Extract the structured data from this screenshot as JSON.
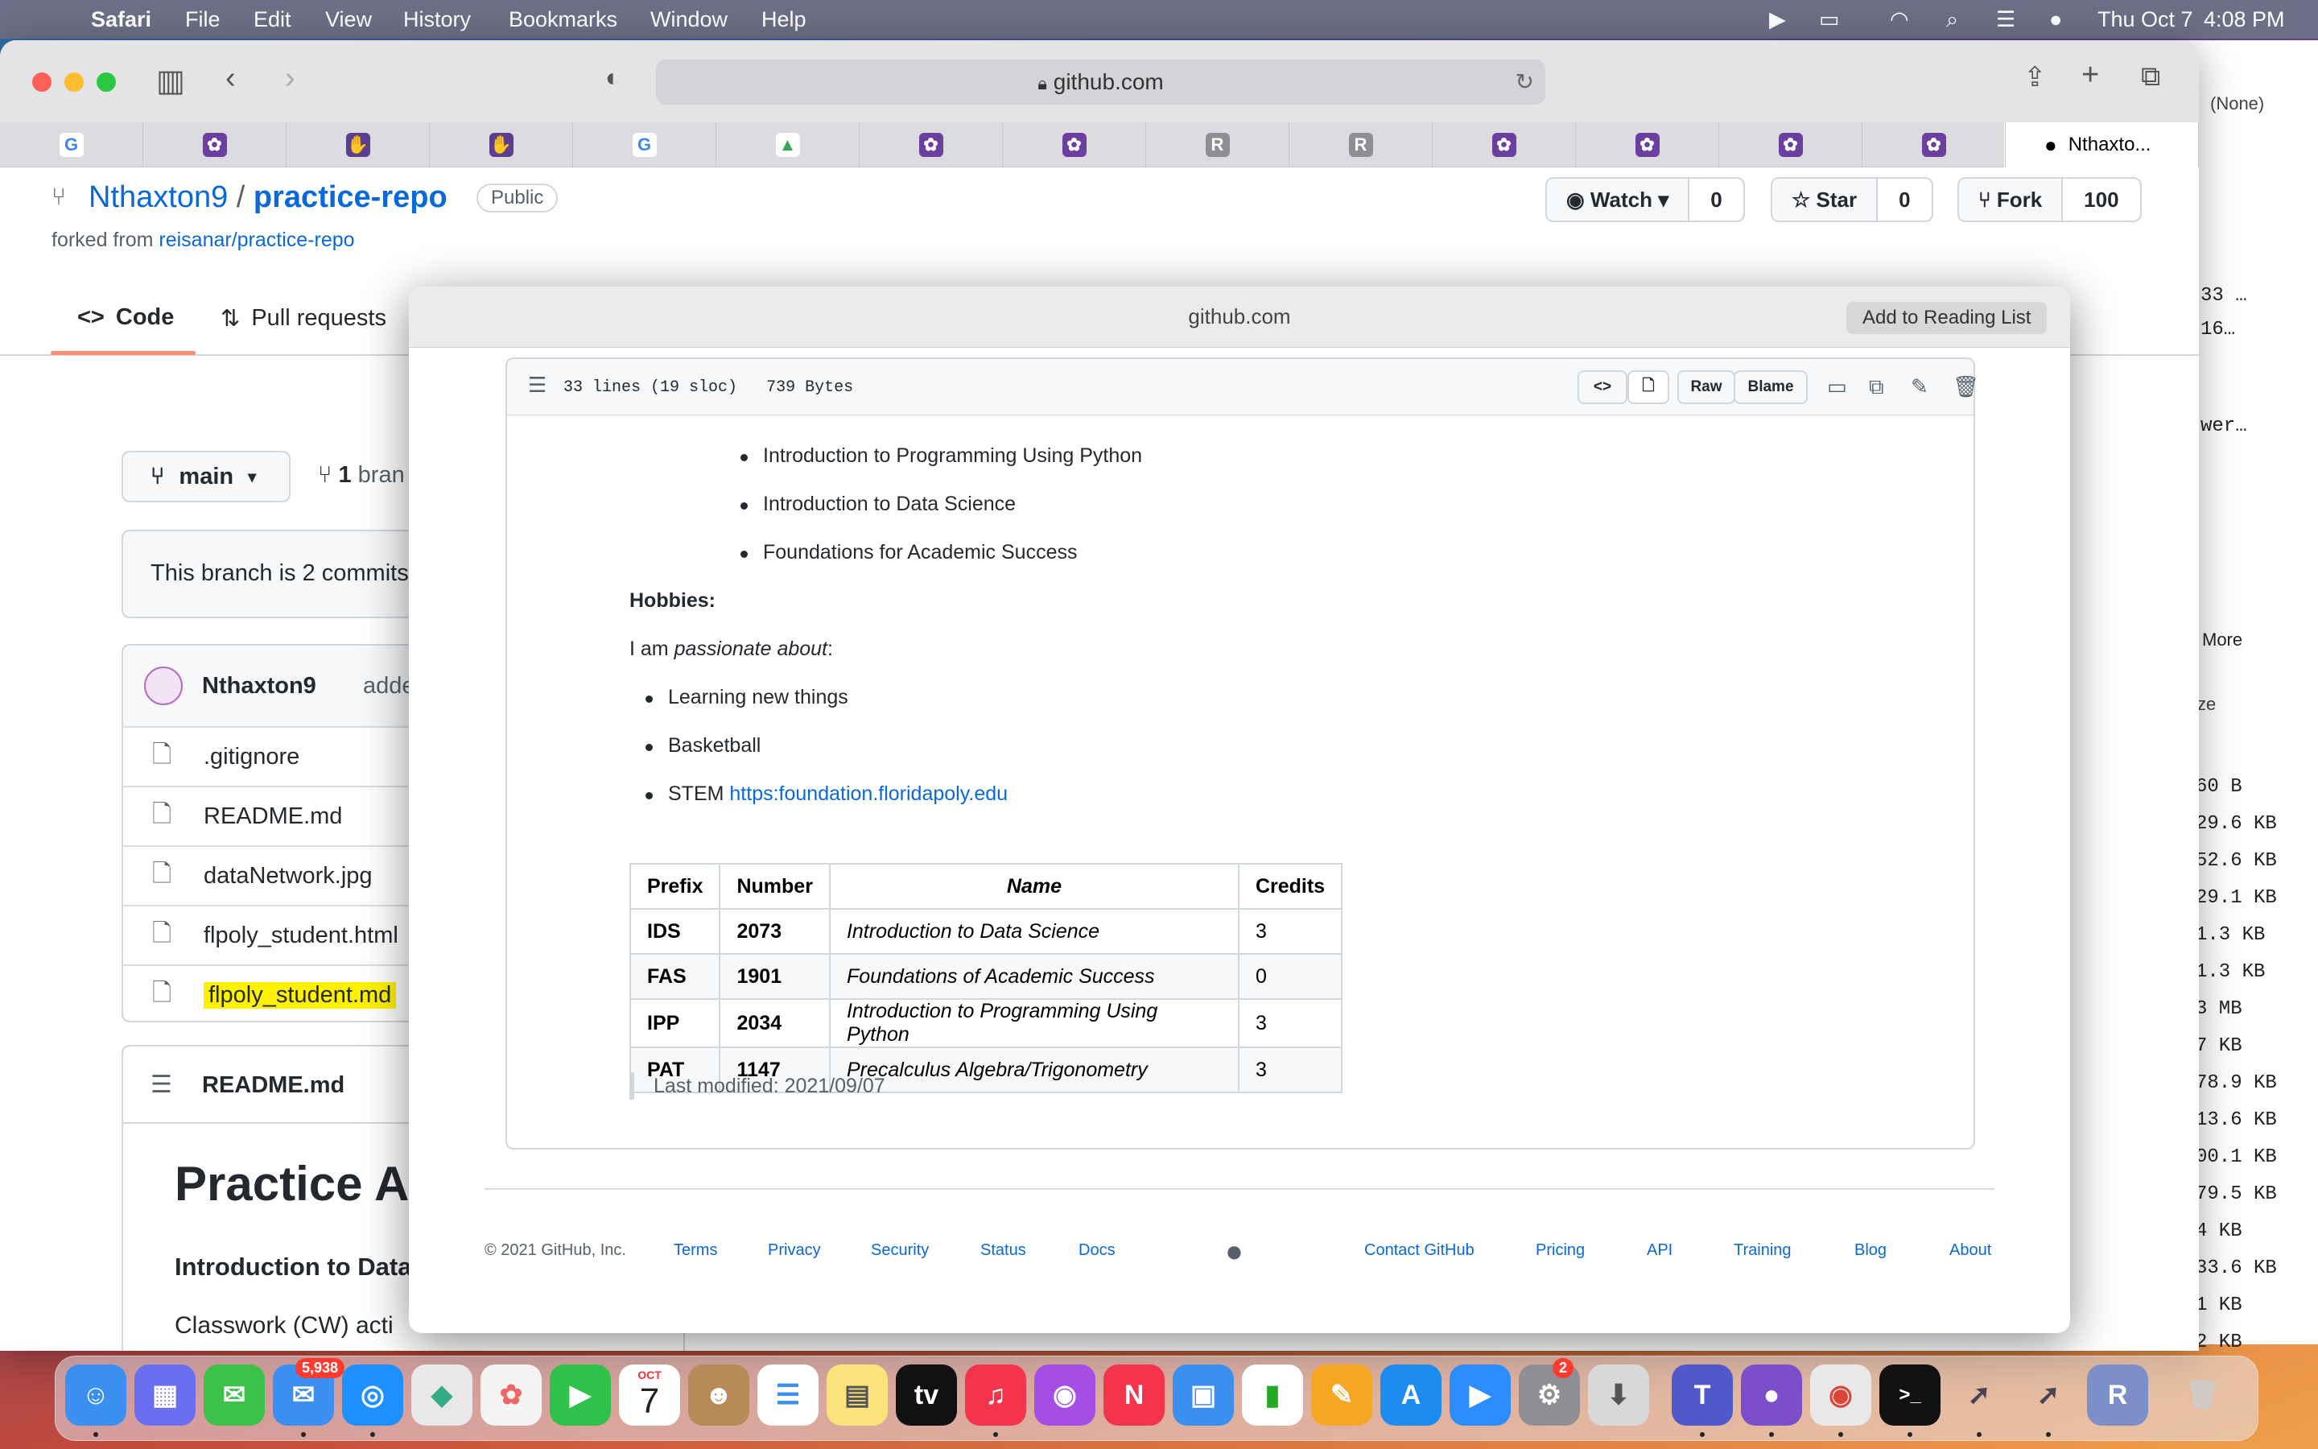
{
  "menubar": {
    "app": "Safari",
    "items": [
      "File",
      "Edit",
      "View",
      "History",
      "Bookmarks",
      "Window",
      "Help"
    ],
    "date": "Thu Oct 7",
    "time": "4:08 PM"
  },
  "browser": {
    "url": "github.com",
    "active_tab_title": "Nthaxto...",
    "tab_favicons": [
      "google",
      "purple-blob",
      "hand",
      "hand",
      "google",
      "drive",
      "purple-blob",
      "purple-blob",
      "R",
      "R",
      "purple-blob",
      "purple-blob",
      "purple-blob",
      "purple-blob"
    ]
  },
  "repo": {
    "owner": "Nthaxton9",
    "separator": "/",
    "name": "practice-repo",
    "visibility": "Public",
    "forked_prefix": "forked from",
    "forked_from": "reisanar/practice-repo",
    "watch_label": "Watch",
    "watch_count": "0",
    "star_label": "Star",
    "star_count": "0",
    "fork_label": "Fork",
    "fork_count": "100"
  },
  "nav": {
    "code": "Code",
    "pulls": "Pull requests"
  },
  "branch": {
    "name": "main",
    "count": "1",
    "label_partial": "bran"
  },
  "branch_status": "This branch is 2 commits",
  "commit": {
    "author": "Nthaxton9",
    "message_partial": "added ta"
  },
  "files": [
    ".gitignore",
    "README.md",
    "dataNetwork.jpg",
    "flpoly_student.html",
    "flpoly_student.md"
  ],
  "readme": {
    "header": "README.md",
    "title_partial": "Practice A",
    "subtitle_partial": "Introduction to Data",
    "line_partial": "Classwork (CW) acti"
  },
  "quicklook": {
    "title": "github.com",
    "add_reading_list": "Add to Reading List",
    "file_info_lines": "33 lines (19 sloc)",
    "file_info_size": "739 Bytes",
    "raw": "Raw",
    "blame": "Blame",
    "courses": [
      "Introduction to Programming Using Python",
      "Introduction to Data Science",
      "Foundations for Academic Success"
    ],
    "hobbies_heading": "Hobbies:",
    "passion_prefix": "I am ",
    "passion_em": "passionate about",
    "passion_suffix": ":",
    "hobbies": [
      "Learning new things",
      "Basketball"
    ],
    "stem_label": "STEM ",
    "stem_link": "https:foundation.floridapoly.edu",
    "table_headers": [
      "Prefix",
      "Number",
      "Name",
      "Credits"
    ],
    "table_rows": [
      [
        "IDS",
        "2073",
        "Introduction to Data Science",
        "3"
      ],
      [
        "FAS",
        "1901",
        "Foundations of Academic Success",
        "0"
      ],
      [
        "IPP",
        "2034",
        "Introduction to Programming Using Python",
        "3"
      ],
      [
        "PAT",
        "1147",
        "Precalculus Algebra/Trigonometry",
        "3"
      ]
    ],
    "last_modified": "Last modified: 2021/09/07"
  },
  "footer": {
    "copyright": "© 2021 GitHub, Inc.",
    "left_links": [
      "Terms",
      "Privacy",
      "Security",
      "Status",
      "Docs"
    ],
    "right_links": [
      "Contact GitHub",
      "Pricing",
      "API",
      "Training",
      "Blog",
      "About"
    ]
  },
  "side_window": {
    "dropdown": "(None)",
    "more": "More",
    "col_partial": "ze",
    "rows": [
      "33 …",
      "16…",
      "wer…"
    ],
    "sizes": [
      "60 B",
      "29.6 KB",
      "52.6 KB",
      "29.1 KB",
      "1.3 KB",
      "1.3 KB",
      "3 MB",
      "7 KB",
      "78.9 KB",
      "13.6 KB",
      "00.1 KB",
      "79.5 KB",
      "4 KB",
      "33.6 KB",
      "1 KB",
      "2 KB"
    ]
  },
  "dock": {
    "mail_badge": "5,938",
    "calendar_month": "OCT",
    "calendar_day": "7",
    "prefs_badge": "2"
  },
  "colors": {
    "link": "#0969da",
    "accent_tab": "#fd8c73",
    "highlight": "#fff200"
  }
}
